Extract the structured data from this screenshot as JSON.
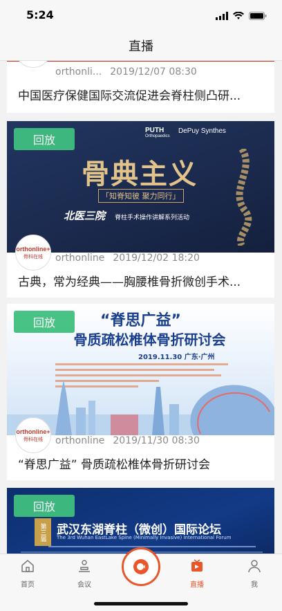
{
  "status_bar": {
    "time": "5:24"
  },
  "nav": {
    "title": "直播"
  },
  "feed": {
    "badge_label": "回放",
    "items": [
      {
        "source": "orthonli...",
        "date": "2019/12/07 08:30",
        "title": "中国医疗保健国际交流促进会脊柱侧凸研..."
      },
      {
        "source": "orthonline",
        "date": "2019/12/02 18:20",
        "title": "古典，常为经典——胸腰椎骨折微创手术...",
        "banner": {
          "sponsor1": "PUTH",
          "sponsor1_sub": "Orthopaedics",
          "sponsor2": "DePuy Synthes",
          "headline": "骨典主义",
          "tagline": "「知脊知彼 聚力同行」",
          "series": "北医三院",
          "series_desc": "脊柱手术操作讲解系列活动"
        }
      },
      {
        "source": "orthonline",
        "date": "2019/11/30 08:30",
        "title": "“脊思广益” 骨质疏松椎体骨折研讨会",
        "banner": {
          "headline": "“脊思广益”",
          "subheadline": "骨质疏松椎体骨折研讨会",
          "date_place": "2019.11.30  广东·广州"
        }
      },
      {
        "title": "",
        "banner": {
          "edition": "第三届",
          "headline": "武汉东湖脊柱（微创）国际论坛",
          "en": "The 3rd Wuhan EastLake Spine (Minimally Invasive) International Forum"
        }
      }
    ]
  },
  "logo": {
    "main": "orthonline+",
    "sub": "骨科在线"
  },
  "tabs": [
    {
      "label": "首页",
      "icon": "home-icon"
    },
    {
      "label": "会议",
      "icon": "meeting-icon"
    },
    {
      "label": "直播",
      "icon": "live-icon",
      "active": true
    },
    {
      "label": "我",
      "icon": "user-icon"
    }
  ],
  "colors": {
    "accent": "#e8562a",
    "badge": "#3fbf7f",
    "banner_navy": "#1b2a4e"
  }
}
